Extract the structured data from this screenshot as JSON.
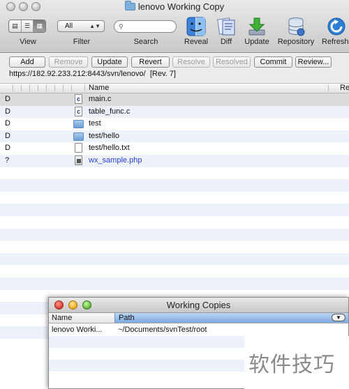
{
  "window": {
    "title": "lenovo Working Copy"
  },
  "toolbar": {
    "view_label": "View",
    "view_modes": [
      "▤",
      "☰",
      "▦"
    ],
    "filter_label": "Filter",
    "filter_value": "All",
    "search_label": "Search",
    "search_placeholder": "",
    "reveal_label": "Reveal",
    "diff_label": "Diff",
    "update_label": "Update",
    "repository_label": "Repository",
    "refresh_label": "Refresh"
  },
  "actions": {
    "add": "Add",
    "remove": "Remove",
    "update": "Update",
    "revert": "Revert",
    "resolve": "Resolve",
    "resolved": "Resolved",
    "commit": "Commit",
    "review": "Review..."
  },
  "repo": {
    "url": "https://182.92.233.212:8443/svn/lenovo/",
    "revision": "[Rev. 7]"
  },
  "list": {
    "header_name": "Name",
    "header_right": "Re",
    "files": [
      {
        "status": "D",
        "name": "main.c",
        "type": "c-file"
      },
      {
        "status": "D",
        "name": "table_func.c",
        "type": "c-file"
      },
      {
        "status": "D",
        "name": "test",
        "type": "folder"
      },
      {
        "status": "D",
        "name": "test/hello",
        "type": "folder"
      },
      {
        "status": "D",
        "name": "test/hello.txt",
        "type": "text-file"
      },
      {
        "status": "?",
        "name": "wx_sample.php",
        "type": "php-file"
      }
    ]
  },
  "working_copies": {
    "title": "Working Copies",
    "col_name": "Name",
    "col_path": "Path",
    "rows": [
      {
        "name": "lenovo Worki...",
        "path": "~/Documents/svnTest/root"
      }
    ]
  },
  "watermark": "软件技巧"
}
